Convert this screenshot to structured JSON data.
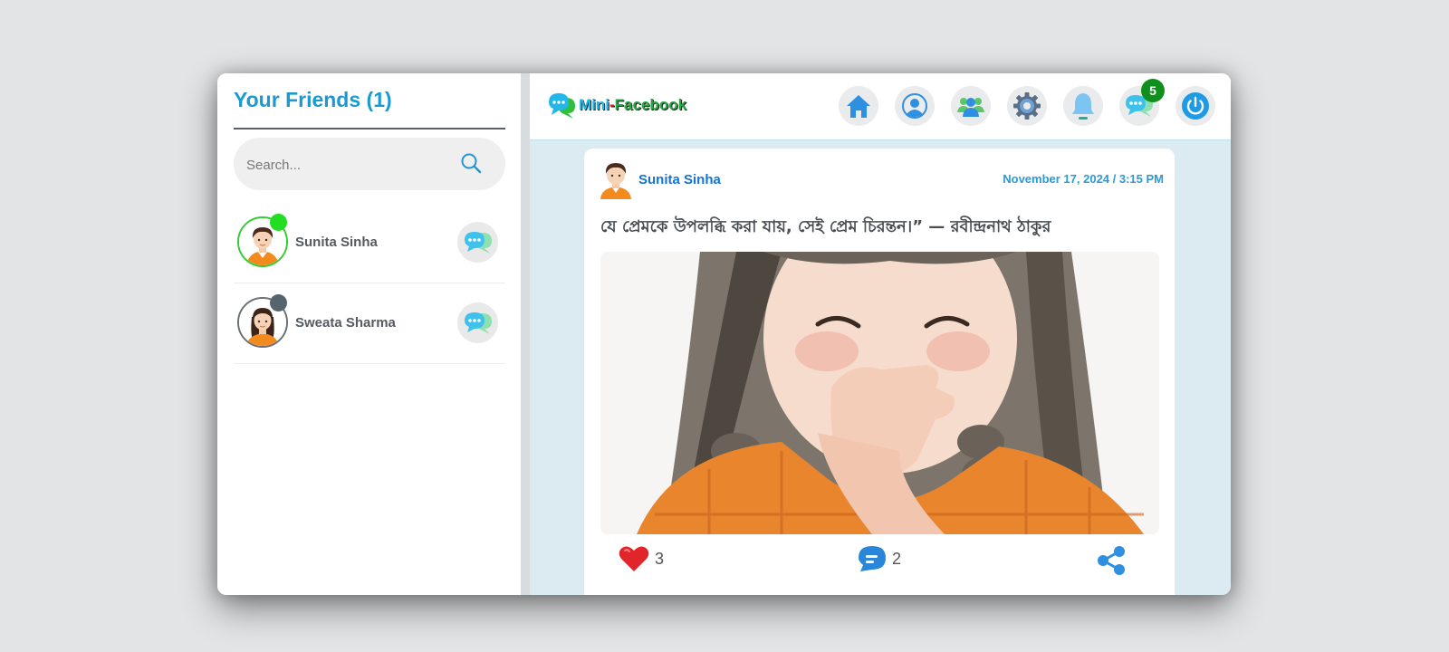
{
  "sidebar": {
    "title": "Your Friends (1)",
    "search": {
      "placeholder": "Search...",
      "value": ""
    },
    "friends": [
      {
        "name": "Sunita Sinha",
        "status": "online",
        "status_color": "#22dd22",
        "ring_color": "#33cc33"
      },
      {
        "name": "Sweata Sharma",
        "status": "offline",
        "status_color": "#55656b",
        "ring_color": "#6a7075"
      }
    ]
  },
  "header": {
    "logo": {
      "mini": "Mini",
      "dash": "-",
      "facebook": "Facebook"
    },
    "nav": [
      {
        "name": "home-icon"
      },
      {
        "name": "profile-icon"
      },
      {
        "name": "friends-icon"
      },
      {
        "name": "settings-icon"
      },
      {
        "name": "notifications-icon"
      },
      {
        "name": "messages-icon",
        "badge": "5"
      },
      {
        "name": "logout-icon"
      }
    ]
  },
  "post": {
    "author": "Sunita Sinha",
    "timestamp": "November 17, 2024 / 3:15 PM",
    "text": "যে প্রেমকে উপলব্ধি করা যায়, সেই প্রেম চিরন্তন।” — রবীন্দ্রনাথ ঠাকুর",
    "image": "photo-of-laughing-girl",
    "likes": "3",
    "comments": "2"
  },
  "colors": {
    "accent": "#1a9ad0",
    "author_link": "#1473d6",
    "online": "#22dd22",
    "badge": "#0f8f1c",
    "feed_bg": "#dcebf1"
  }
}
